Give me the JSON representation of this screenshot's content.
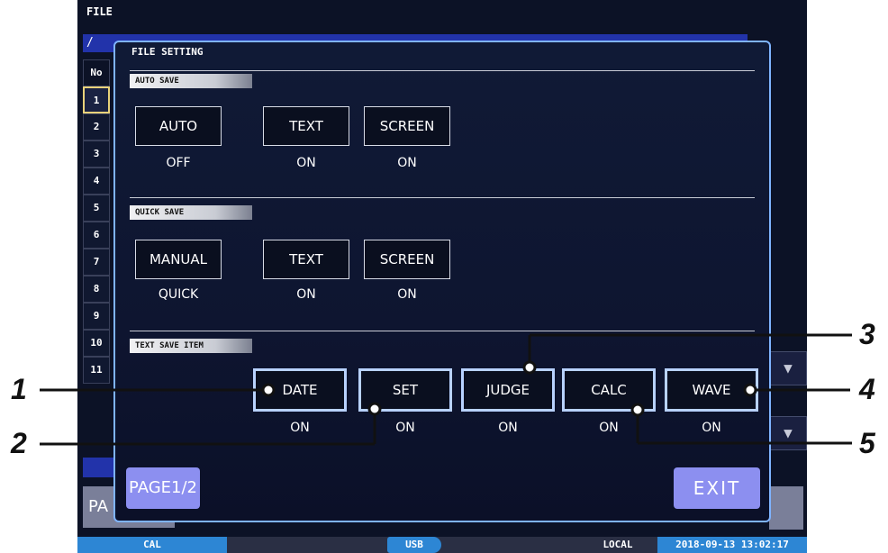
{
  "screen": {
    "title": "FILE",
    "path": "/",
    "table_header": "No",
    "row_numbers": [
      "1",
      "2",
      "3",
      "4",
      "5",
      "6",
      "7",
      "8",
      "9",
      "10",
      "11"
    ],
    "page_button_partial": "PA",
    "right_arrow_icon": "triangle-down-icon"
  },
  "dialog": {
    "title": "FILE SETTING",
    "auto_save": {
      "label": "AUTO SAVE",
      "mode_button": "AUTO",
      "mode_value": "OFF",
      "text_button": "TEXT",
      "text_value": "ON",
      "screen_button": "SCREEN",
      "screen_value": "ON"
    },
    "quick_save": {
      "label": "QUICK SAVE",
      "mode_button": "MANUAL",
      "mode_value": "QUICK",
      "text_button": "TEXT",
      "text_value": "ON",
      "screen_button": "SCREEN",
      "screen_value": "ON"
    },
    "text_save_item": {
      "label": "TEXT SAVE ITEM",
      "items": [
        {
          "label": "DATE",
          "value": "ON"
        },
        {
          "label": "SET",
          "value": "ON"
        },
        {
          "label": "JUDGE",
          "value": "ON"
        },
        {
          "label": "CALC",
          "value": "ON"
        },
        {
          "label": "WAVE",
          "value": "ON"
        }
      ]
    },
    "page_button": "PAGE1/2",
    "exit_button": "EXIT"
  },
  "status_bar": {
    "cal": "CAL",
    "usb": "USB",
    "local": "LOCAL",
    "datetime": "2018-09-13 13:02:17"
  },
  "callouts": [
    "1",
    "2",
    "3",
    "4",
    "5"
  ],
  "colors": {
    "screen_bg": "#0c1226",
    "dialog_border": "#7fb4ff",
    "button_accent": "#8c8ff0",
    "status_blue": "#2d86d4"
  }
}
